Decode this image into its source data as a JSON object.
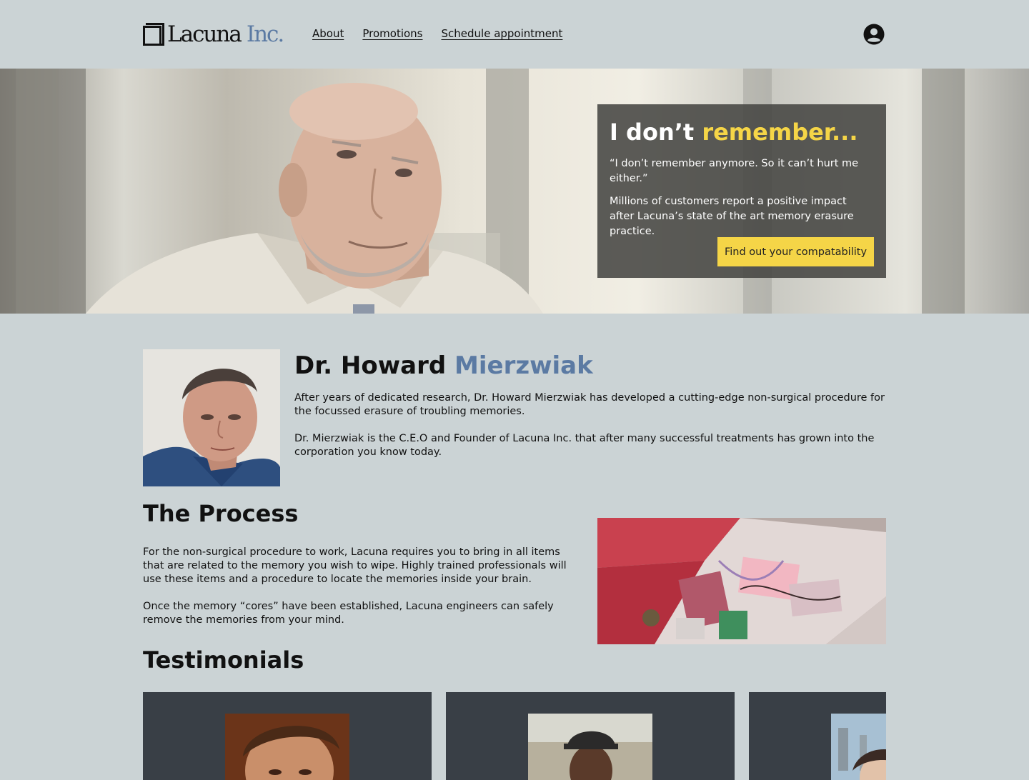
{
  "brand": {
    "name": "Lacuna",
    "suffix": "Inc.",
    "accent_color": "#5b7aa3",
    "highlight_color": "#f5d547"
  },
  "nav": {
    "items": [
      {
        "label": "About"
      },
      {
        "label": "Promotions"
      },
      {
        "label": "Schedule appointment"
      }
    ],
    "account_icon": "user-circle-icon"
  },
  "hero": {
    "title_plain": "I don’t ",
    "title_accent": "remember...",
    "quote": "“I don’t remember anymore. So it can’t hurt me either.”",
    "body": "Millions of customers report a positive impact after Lacuna’s state of the art memory erasure practice.",
    "cta_label": "Find out your compatability"
  },
  "doctor": {
    "first": "Dr. Howard ",
    "last": "Mierzwiak",
    "paragraphs": [
      "After years of dedicated research, Dr. Howard Mierzwiak has developed a cutting-edge non-surgical procedure for the focussed erasure of troubling memories.",
      "Dr. Mierzwiak is the C.E.O and Founder of Lacuna Inc. that after many successful treatments has grown into the corporation you know today."
    ]
  },
  "process": {
    "title": "The Process",
    "paragraphs": [
      "For the non-surgical procedure to work, Lacuna requires you to bring in all items that are related to the memory you wish to wipe. Highly trained professionals will use these items and a procedure to locate the memories inside your brain.",
      "Once the memory “cores” have been established, Lacuna engineers can safely remove the memories from your mind."
    ]
  },
  "testimonials": {
    "title": "Testimonials"
  }
}
